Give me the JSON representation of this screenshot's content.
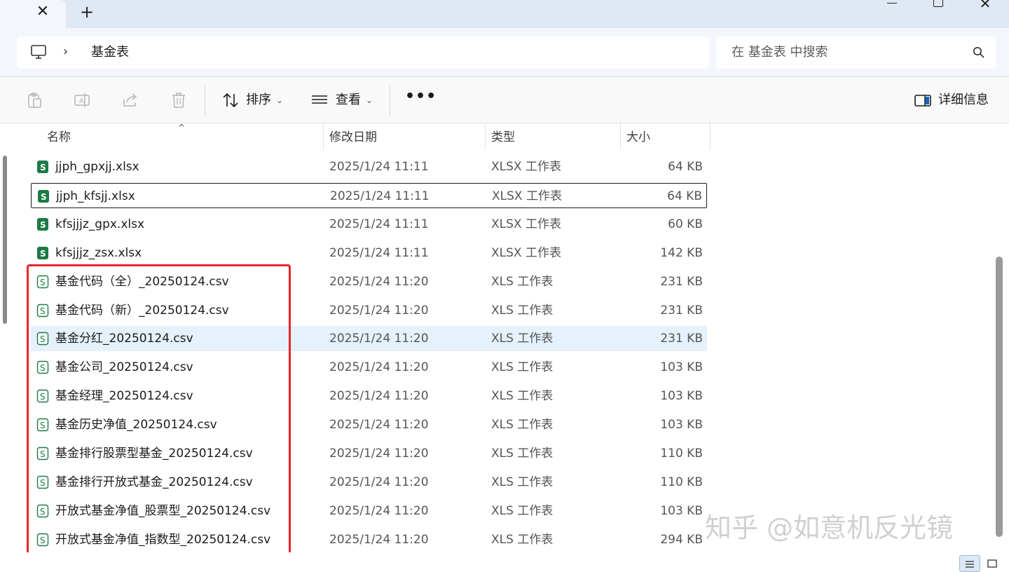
{
  "tabs": {
    "close_label": "✕",
    "new_tab_label": "+",
    "window_close_label": "✕"
  },
  "address": {
    "separator": "›",
    "crumb": "基金表"
  },
  "search": {
    "placeholder": "在 基金表 中搜索"
  },
  "toolbar": {
    "sort_label": "排序",
    "view_label": "查看",
    "caret": "⌄",
    "more_label": "•••",
    "details_label": "详细信息"
  },
  "columns": {
    "name": "名称",
    "date": "修改日期",
    "type": "类型",
    "size": "大小",
    "sort_indicator": "^"
  },
  "files": [
    {
      "name": "jjph_gpxjj.xlsx",
      "date": "2025/1/24 11:11",
      "type": "XLSX 工作表",
      "size": "64 KB",
      "kind": "xlsx"
    },
    {
      "name": "jjph_kfsjj.xlsx",
      "date": "2025/1/24 11:11",
      "type": "XLSX 工作表",
      "size": "64 KB",
      "kind": "xlsx"
    },
    {
      "name": "kfsjjjz_gpx.xlsx",
      "date": "2025/1/24 11:11",
      "type": "XLSX 工作表",
      "size": "60 KB",
      "kind": "xlsx"
    },
    {
      "name": "kfsjjjz_zsx.xlsx",
      "date": "2025/1/24 11:11",
      "type": "XLSX 工作表",
      "size": "142 KB",
      "kind": "xlsx"
    },
    {
      "name": "基金代码（全）_20250124.csv",
      "date": "2025/1/24 11:20",
      "type": "XLS 工作表",
      "size": "231 KB",
      "kind": "csv"
    },
    {
      "name": "基金代码（新）_20250124.csv",
      "date": "2025/1/24 11:20",
      "type": "XLS 工作表",
      "size": "231 KB",
      "kind": "csv"
    },
    {
      "name": "基金分红_20250124.csv",
      "date": "2025/1/24 11:20",
      "type": "XLS 工作表",
      "size": "231 KB",
      "kind": "csv"
    },
    {
      "name": "基金公司_20250124.csv",
      "date": "2025/1/24 11:20",
      "type": "XLS 工作表",
      "size": "103 KB",
      "kind": "csv"
    },
    {
      "name": "基金经理_20250124.csv",
      "date": "2025/1/24 11:20",
      "type": "XLS 工作表",
      "size": "103 KB",
      "kind": "csv"
    },
    {
      "name": "基金历史净值_20250124.csv",
      "date": "2025/1/24 11:20",
      "type": "XLS 工作表",
      "size": "103 KB",
      "kind": "csv"
    },
    {
      "name": "基金排行股票型基金_20250124.csv",
      "date": "2025/1/24 11:20",
      "type": "XLS 工作表",
      "size": "110 KB",
      "kind": "csv"
    },
    {
      "name": "基金排行开放式基金_20250124.csv",
      "date": "2025/1/24 11:20",
      "type": "XLS 工作表",
      "size": "110 KB",
      "kind": "csv"
    },
    {
      "name": "开放式基金净值_股票型_20250124.csv",
      "date": "2025/1/24 11:20",
      "type": "XLS 工作表",
      "size": "103 KB",
      "kind": "csv"
    },
    {
      "name": "开放式基金净值_指数型_20250124.csv",
      "date": "2025/1/24 11:20",
      "type": "XLS 工作表",
      "size": "294 KB",
      "kind": "csv"
    }
  ],
  "watermark": "知乎 @如意机反光镜",
  "colors": {
    "accent": "#0067c0",
    "excel_green": "#1d7a45",
    "highlight_red": "#e8262a",
    "hover_row": "#e5f1fb"
  }
}
